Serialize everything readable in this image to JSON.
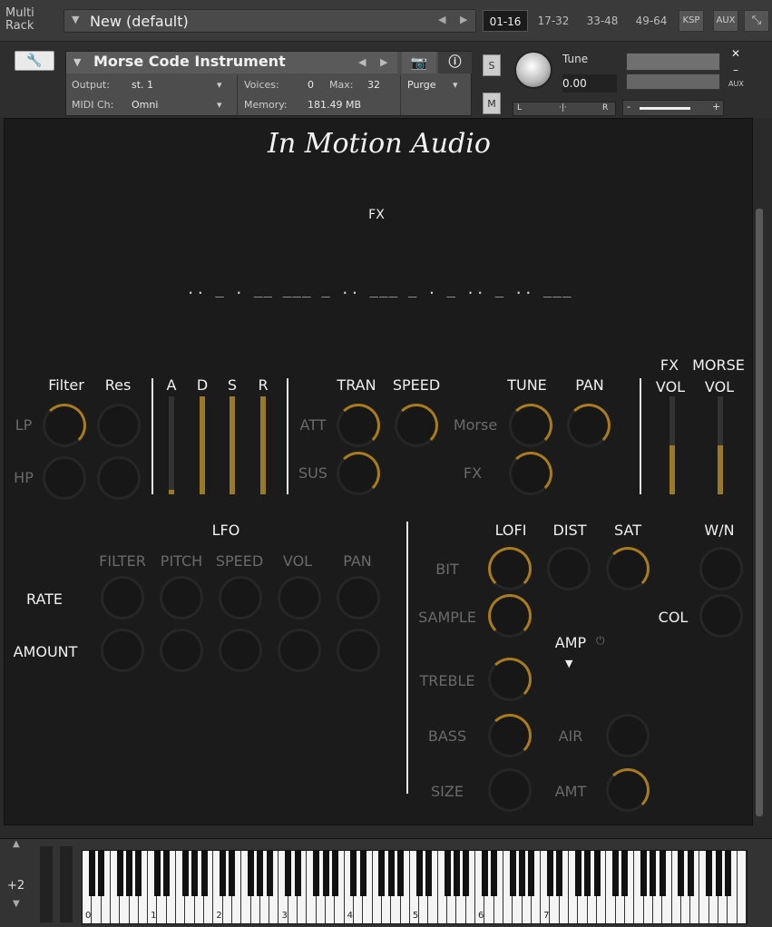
{
  "topbar": {
    "multi_rack_label": "Multi\nRack",
    "rack_name": "New (default)",
    "pages": [
      "01-16",
      "17-32",
      "33-48",
      "49-64"
    ],
    "ksp_label": "KSP",
    "aux_label": "AUX"
  },
  "instrument": {
    "name": "Morse Code Instrument",
    "output_label": "Output:",
    "output_value": "st. 1",
    "midi_label": "MIDI Ch:",
    "midi_value": "Omni",
    "voices_label": "Voices:",
    "voices_value": "0",
    "max_label": "Max:",
    "max_value": "32",
    "memory_label": "Memory:",
    "memory_value": "181.49 MB",
    "purge_label": "Purge",
    "solo_label": "S",
    "mute_label": "M",
    "tune_label": "Tune",
    "tune_value": "0.00",
    "pan_left": "L",
    "pan_center": "·|·",
    "pan_right": "R",
    "vol_minus": "-",
    "vol_plus": "+",
    "aux_small": "AUX"
  },
  "panel": {
    "logo": "In Motion Audio",
    "fx_title": "FX",
    "morse_text": ".. _ .   __ ___ _ .. ___ _ .  _ .. _ .. ___",
    "filter": {
      "title": "Filter",
      "res": "Res",
      "lp": "LP",
      "hp": "HP"
    },
    "adsr": {
      "a": "A",
      "d": "D",
      "s": "S",
      "r": "R",
      "levels": [
        0.05,
        1.0,
        1.0,
        1.0
      ]
    },
    "tran": {
      "tran": "TRAN",
      "speed": "SPEED",
      "att": "ATT",
      "sus": "SUS"
    },
    "tune": {
      "tune": "TUNE",
      "pan": "PAN",
      "morse": "Morse",
      "fx": "FX"
    },
    "vol": {
      "fx": "FX",
      "morse": "MORSE",
      "vol1": "VOL",
      "vol2": "VOL",
      "levels": [
        0.5,
        0.5
      ]
    },
    "lfo": {
      "title": "LFO",
      "cols": [
        "FILTER",
        "PITCH",
        "SPEED",
        "VOL",
        "PAN"
      ],
      "rate": "RATE",
      "amount": "AMOUNT"
    },
    "fx": {
      "lofi": "LOFI",
      "dist": "DIST",
      "sat": "SAT",
      "wn": "W/N",
      "bit": "BIT",
      "sample": "SAMPLE",
      "col": "COL",
      "amp": "AMP",
      "treble": "TREBLE",
      "bass": "BASS",
      "air": "AIR",
      "size": "SIZE",
      "amt": "AMT"
    }
  },
  "keyboard": {
    "octave_shift": "+2",
    "octaves": [
      "0",
      "1",
      "2",
      "3",
      "4",
      "5",
      "6",
      "7"
    ]
  },
  "colors": {
    "accent": "#a77b1e",
    "panel_bg": "#1b1b1b",
    "chrome": "#3a3a3a"
  }
}
